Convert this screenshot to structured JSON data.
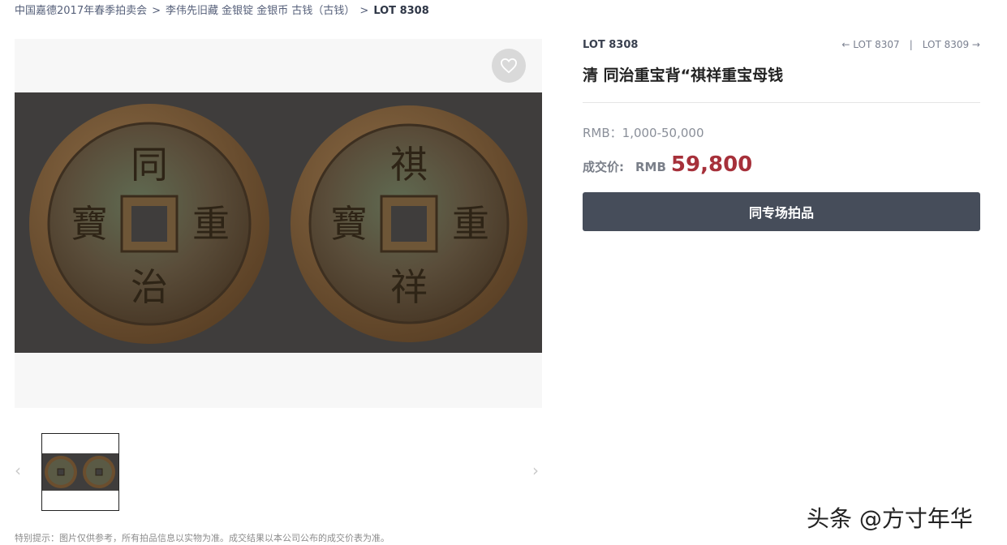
{
  "breadcrumb": {
    "items": [
      "中国嘉德2017年春季拍卖会",
      "李伟先旧藏 金银锭 金银币 古钱（古钱）"
    ],
    "separator": ">",
    "current": "LOT 8308"
  },
  "gallery": {
    "favorite_icon": "heart-icon",
    "coin_left_chars": [
      "同",
      "重",
      "治",
      "寶"
    ],
    "coin_right_chars": [
      "祺",
      "重",
      "祥",
      "寶"
    ],
    "prev_icon": "chevron-left-icon",
    "next_icon": "chevron-right-icon"
  },
  "notice": "特别提示：图片仅供参考，所有拍品信息以实物为准。成交结果以本公司公布的成交价表为准。",
  "lot": {
    "number": "LOT 8308",
    "prev_label": "← LOT 8307",
    "separator": "|",
    "next_label": "LOT 8309 →",
    "title": "清 同治重宝背“祺祥重宝母钱",
    "estimate": "RMB：1,000-50,000",
    "sold_label": "成交价:",
    "sold_currency": "RMB",
    "sold_price": "59,800",
    "same_session_button": "同专场拍品"
  },
  "watermark": "头条 @方寸年华",
  "colors": {
    "price": "#a6303a",
    "button_bg": "#464d5a",
    "photo_bg": "#3f3d3c",
    "coin_rim": "#6b4e2e"
  }
}
